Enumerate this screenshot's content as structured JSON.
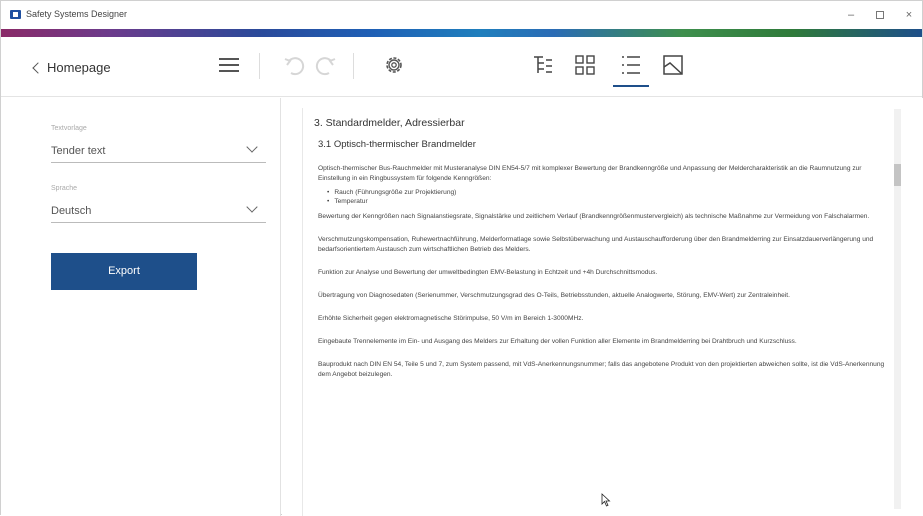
{
  "window": {
    "title": "Safety Systems Designer",
    "minimize": "–",
    "close": "×"
  },
  "toolbar": {
    "back_label": "Homepage"
  },
  "sidebar": {
    "field1": {
      "label": "Textvorlage",
      "value": "Tender text"
    },
    "field2": {
      "label": "Sprache",
      "value": "Deutsch"
    },
    "export_label": "Export"
  },
  "document": {
    "heading": "3. Standardmelder, Adressierbar",
    "subheading": "3.1 Optisch-thermischer Brandmelder",
    "paragraphs": [
      "Optisch-thermischer Bus-Rauchmelder mit Musteranalyse DIN EN54-5/7 mit komplexer Bewertung der Brandkenngröße und Anpassung der Meldercharakteristik an die Raumnutzung zur Einstellung in ein Ringbussystem für folgende Kenngrößen:",
      "Bewertung der Kenngrößen nach Signalanstiegsrate, Signalstärke und zeitlichem Verlauf (Brandkenngrößenmustervergleich) als technische Maßnahme zur Vermeidung von Falschalarmen.",
      "Verschmutzungskompensation, Ruhewertnachführung, Melderformatlage sowie Selbstüberwachung und Austauschaufforderung über den Brandmelderring zur Einsatzdauerverlängerung und bedarfsorientiertem Austausch zum wirtschaftlichen Betrieb des Melders.",
      "Funktion zur Analyse und Bewertung der umweltbedingten EMV-Belastung in Echtzeit und +4h Durchschnittsmodus.",
      "Übertragung von Diagnosedaten (Serienummer, Verschmutzungsgrad des O-Teils, Betriebsstunden, aktuelle Analogwerte, Störung, EMV-Wert) zur Zentraleinheit.",
      "Erhöhte Sicherheit gegen elektromagnetische Störimpulse, 50 V/m im Bereich 1-3000MHz.",
      "Eingebaute Trennelemente im Ein- und Ausgang des Melders zur Erhaltung der vollen Funktion aller Elemente im Brandmelderring bei Drahtbruch und Kurzschluss.",
      "Bauprodukt nach DIN EN 54, Teile 5 und 7, zum System passend, mit VdS-Anerkennungsnummer; falls das angebotene Produkt von den projektierten abweichen sollte, ist die VdS-Anerkennung dem Angebot beizulegen."
    ],
    "bullets": [
      "Rauch (Führungsgröße zur Projektierung)",
      "Temperatur"
    ]
  }
}
